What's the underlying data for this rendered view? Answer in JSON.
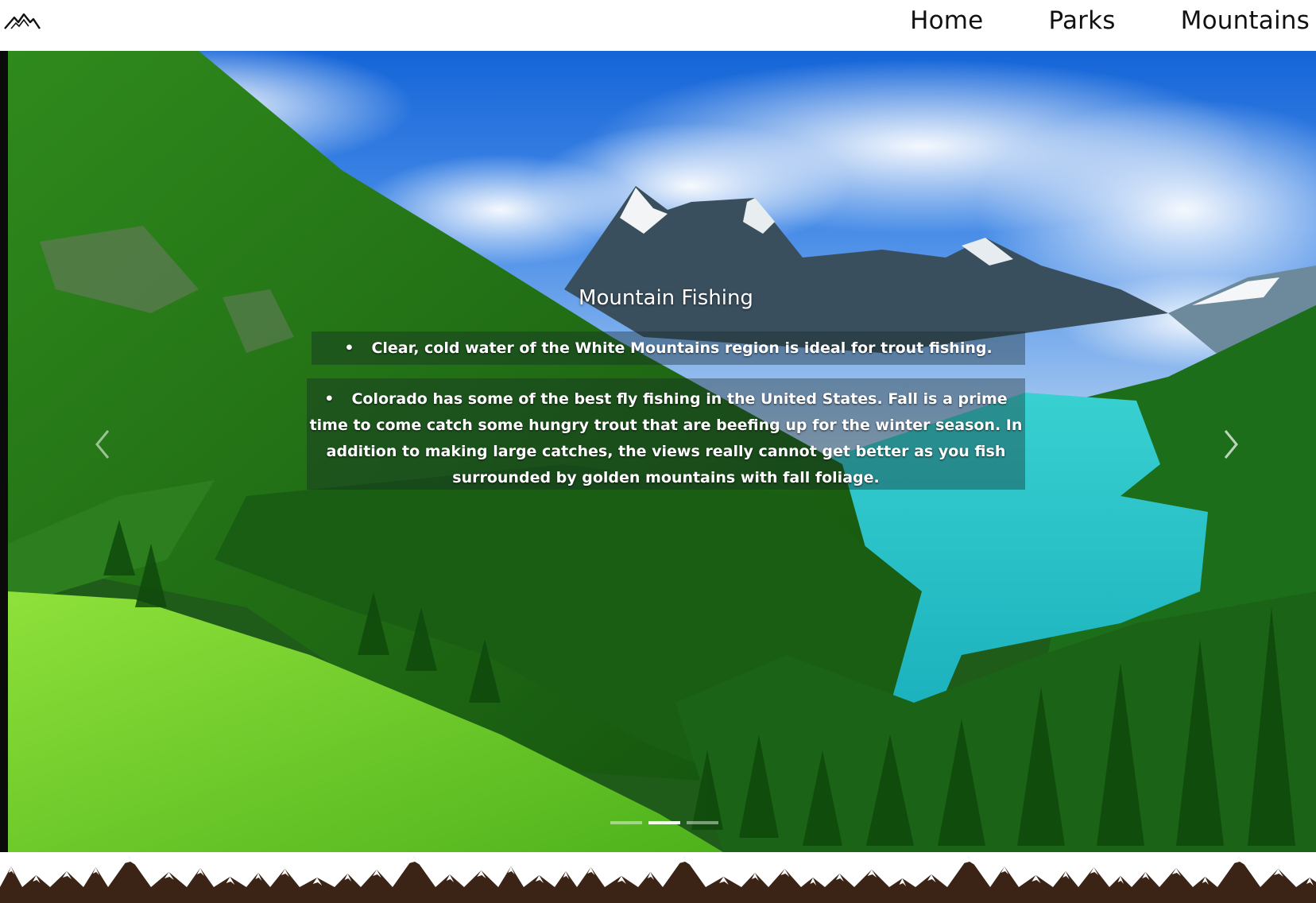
{
  "nav": {
    "logo_icon": "mountain-logo-icon",
    "links": [
      "Home",
      "Parks",
      "Mountains"
    ]
  },
  "carousel": {
    "title": "Mountain Fishing",
    "bullets": [
      "Clear, cold water of the White Mountains region is ideal for trout fishing.",
      "Colorado has some of the best fly fishing in the United States. Fall is a prime time to come catch some hungry trout that are beefing up for the winter season. In addition to making large catches, the views really cannot get better as you fish surrounded by golden mountains with fall foliage."
    ],
    "bullet_char": "•",
    "prev_icon": "chevron-left-icon",
    "next_icon": "chevron-right-icon",
    "slide_count": 3,
    "active_slide": 2
  },
  "footer": {
    "decoration": "mountain-range-border",
    "color": "#3b2416"
  }
}
